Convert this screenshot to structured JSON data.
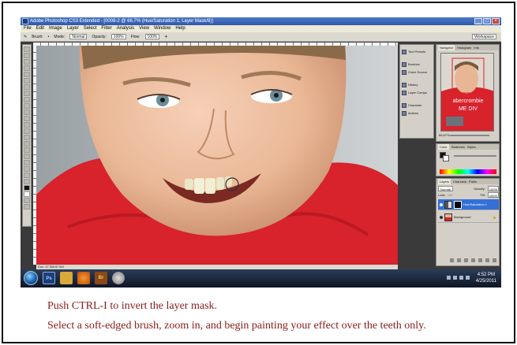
{
  "window": {
    "title": "Adobe Photoshop CS3 Extended - [0008-2 @ 66.7% (Hue/Saturation 1, Layer Mask/8)]",
    "app_icon": "Ps",
    "buttons": [
      "minimize-icon",
      "maximize-icon",
      "close-icon"
    ]
  },
  "menu": {
    "items": [
      "File",
      "Edit",
      "Image",
      "Layer",
      "Select",
      "Filter",
      "Analysis",
      "View",
      "Window",
      "Help"
    ]
  },
  "options": {
    "brush_label": "Brush:",
    "mode_label": "Mode:",
    "mode_value": "Normal",
    "opacity_label": "Opacity:",
    "opacity_value": "100%",
    "flow_label": "Flow:",
    "flow_value": "100%",
    "workspace_label": "Workspace"
  },
  "status": {
    "text": "Doc: 47.5M/47.5M"
  },
  "dock": {
    "items": [
      "Tool Presets",
      "Brushes",
      "Clone Source",
      "History",
      "Layer Comps",
      "Character",
      "Actions"
    ]
  },
  "navigator": {
    "tabs": [
      "Navigator",
      "Histogram",
      "Info"
    ],
    "zoom": "66.67%"
  },
  "color_panel": {
    "tabs": [
      "Color",
      "Swatches",
      "Styles"
    ]
  },
  "layers_panel": {
    "tabs": [
      "Layers",
      "Channels",
      "Paths"
    ],
    "blend_mode": "Normal",
    "opacity_label": "Opacity:",
    "opacity_value": "100%",
    "lock_label": "Lock:",
    "fill_label": "Fill:",
    "fill_value": "100%",
    "layers": [
      {
        "name": "Hue/Saturation 1",
        "selected": true
      },
      {
        "name": "Background",
        "selected": false
      }
    ]
  },
  "shirt_text": {
    "line1": "abercrombie",
    "line2": "ME DIV"
  },
  "taskbar": {
    "apps": [
      "Ps",
      "Br"
    ],
    "time": "4:52 PM",
    "date": "4/25/2011"
  },
  "captions": {
    "line1": "Push CTRL-I to invert the layer mask.",
    "line2": "Select a soft-edged brush, zoom in, and begin painting your effect over the teeth only."
  },
  "colors": {
    "caption": "#8b1a1a",
    "title_bar": "#2f5aa8",
    "selected_layer": "#3470d8",
    "shirt": "#d8222c"
  }
}
